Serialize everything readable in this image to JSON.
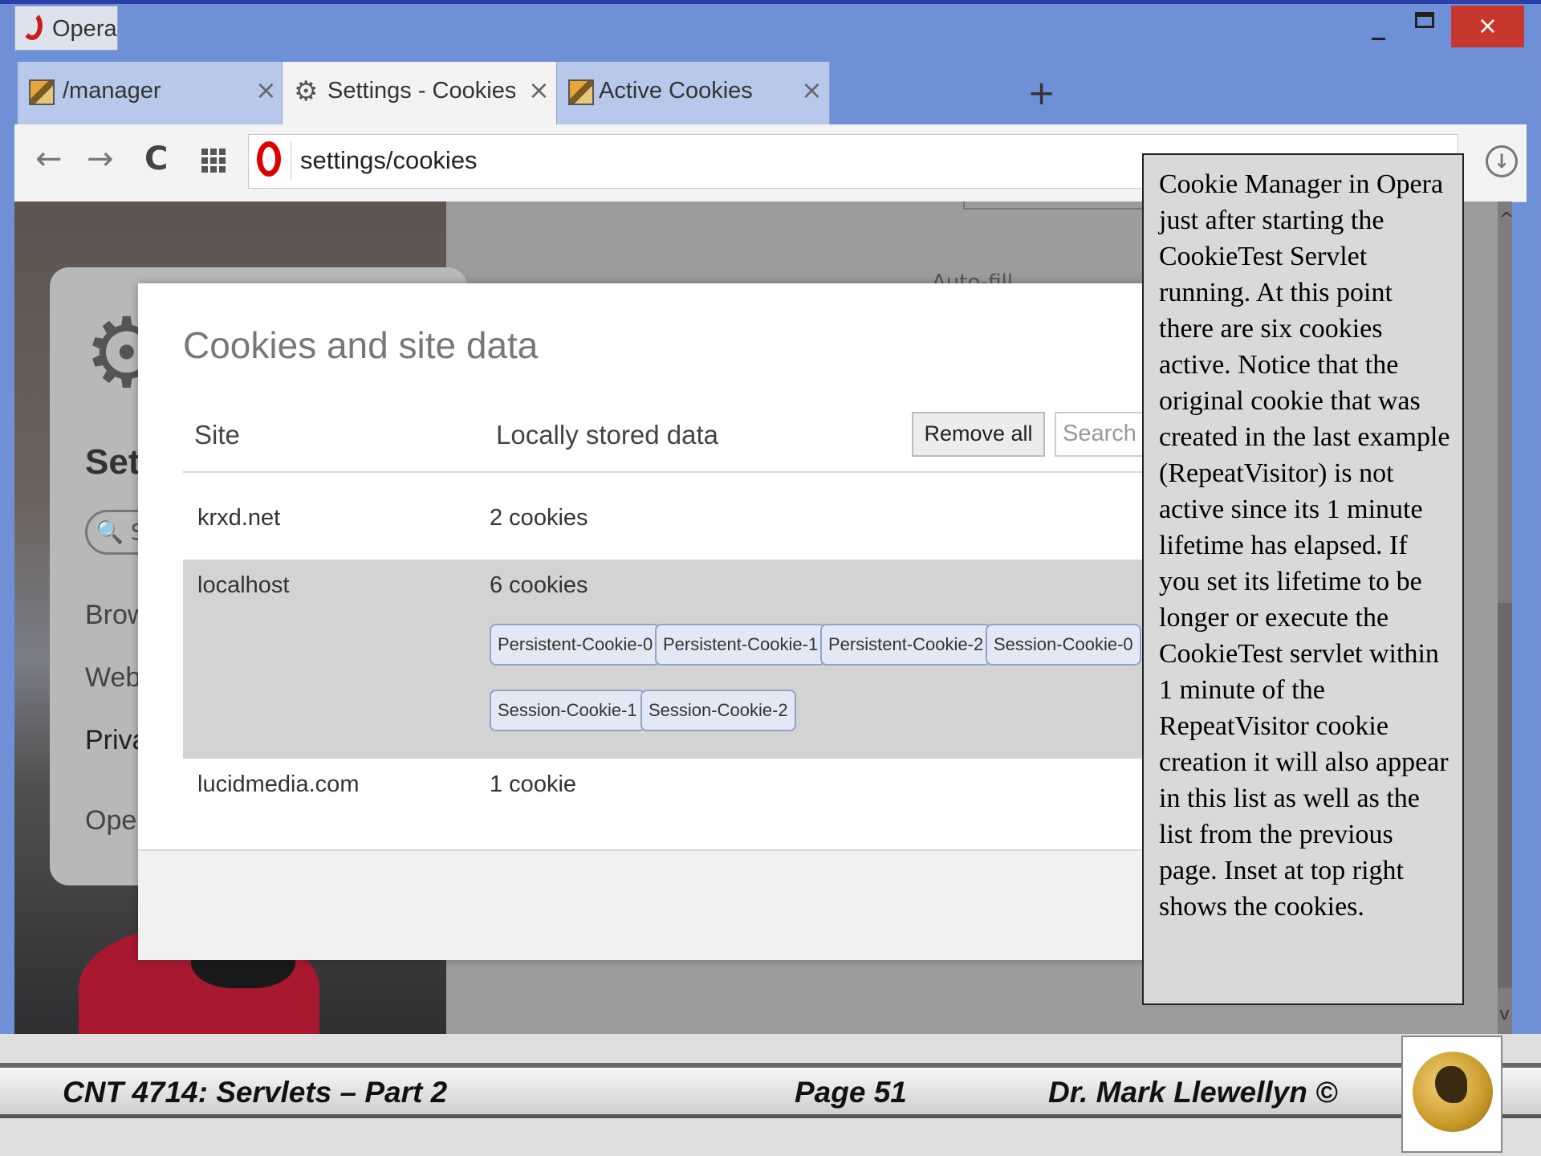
{
  "window": {
    "app_name": "Opera",
    "minimize": "_",
    "close": "×"
  },
  "tabs": [
    {
      "title": "/manager",
      "close": "×"
    },
    {
      "title": "Settings - Cookies and site",
      "close": "×"
    },
    {
      "title": "Active Cookies",
      "close": "×"
    }
  ],
  "new_tab": "+",
  "toolbar": {
    "back": "←",
    "forward": "→",
    "reload": "C",
    "url": "settings/cookies"
  },
  "settings_sidebar": {
    "title": "Sett",
    "search_placeholder": "Se",
    "items": [
      "Brow",
      "Webs",
      "Priva",
      "Oper"
    ]
  },
  "behind_text": "Auto-fill",
  "dialog": {
    "title": "Cookies and site data",
    "col_site": "Site",
    "col_data": "Locally stored data",
    "remove_all": "Remove all",
    "search_placeholder": "Search cookies",
    "rows": [
      {
        "site": "krxd.net",
        "data": "2 cookies"
      },
      {
        "site": "localhost",
        "data": "6 cookies",
        "chips": [
          "Persistent-Cookie-0",
          "Persistent-Cookie-1",
          "Persistent-Cookie-2",
          "Session-Cookie-0",
          "Session-Cookie-1",
          "Session-Cookie-2"
        ]
      },
      {
        "site": "lucidmedia.com",
        "data": "1 cookie"
      },
      {
        "site": "",
        "data": ""
      }
    ]
  },
  "caption": "Cookie Manager in Opera just after starting the CookieTest Servlet running.  At this point there are six cookies active.  Notice that the original cookie that was created in the last example (RepeatVisitor) is not active since its 1 minute lifetime has elapsed.  If you set its lifetime to be longer or execute the CookieTest servlet within 1 minute of the RepeatVisitor cookie creation it will also appear in this list as well as the list from the previous page. Inset at top right shows the cookies.",
  "footer": {
    "course": "CNT 4714: Servlets – Part 2",
    "page": "Page 51",
    "author": "Dr. Mark Llewellyn ©"
  }
}
